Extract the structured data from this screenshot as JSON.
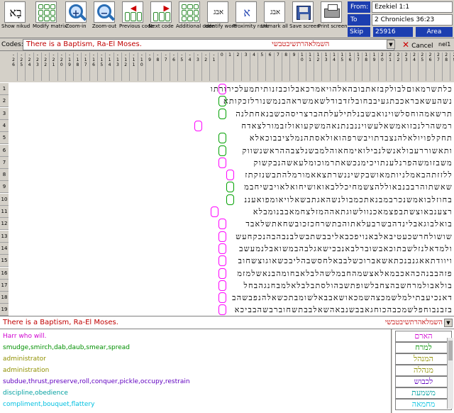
{
  "toolbar": {
    "buttons": [
      {
        "label": "Show nikud",
        "glyph": "בָא"
      },
      {
        "label": "Modify matrix"
      },
      {
        "label": "Zoom-in",
        "glyph": "+"
      },
      {
        "label": "Zoom-out",
        "glyph": "−"
      },
      {
        "label": "Previous code",
        "glyph": "◀"
      },
      {
        "label": "Next code",
        "glyph": "▶"
      },
      {
        "label": "Additional code"
      },
      {
        "label": "Identify word",
        "glyph": "אבג"
      },
      {
        "label": "Proximity rank",
        "glyph": "א"
      },
      {
        "label": "Unmark all",
        "glyph": "אבג"
      },
      {
        "label": "Save screen"
      },
      {
        "label": "Print screen"
      }
    ]
  },
  "range": {
    "from_label": "From:",
    "from_value": "Ezekiel 1:1",
    "to_label": "To",
    "to_value": "2 Chronicles 36:23",
    "skip_label": "Skip",
    "skip_value": "25916",
    "area_label": "Area"
  },
  "codes": {
    "label": "Codes:",
    "value": "There is a Baptism, Ra-El Moses.",
    "hebrew": "השמלאהרתשיבטבשי",
    "cancel_label": "Cancel",
    "user_field": "nel1"
  },
  "matrix": {
    "columns": [
      "-26",
      "-25",
      "-24",
      "-23",
      "-22",
      "-21",
      "-20",
      "-19",
      "-18",
      "-17",
      "-16",
      "-15",
      "-14",
      "-13",
      "-12",
      "-11",
      "-10",
      "-9",
      "-8",
      "-7",
      "-6",
      "-5",
      "-4",
      "-3",
      "-2",
      "-1",
      "0",
      "1",
      "2",
      "3",
      "4",
      "5",
      "6",
      "7",
      "8",
      "9",
      "10",
      "11",
      "12",
      "13",
      "14",
      "15",
      "16",
      "17",
      "18",
      "19",
      "20",
      "21",
      "22",
      "23",
      "24",
      "25",
      "26",
      "27",
      "28",
      "29"
    ],
    "rows": [
      {
        "n": "1",
        "text": "כלתשרמאוםלבולקבזאתבובהאלהויאמרכאבלוכבזנותיתמעלכירורתו"
      },
      {
        "n": "2",
        "text": "נשהעשאבראכבתגעיבבחובלזדבודלשאמשראהבנמשנורלזכקותא"
      },
      {
        "n": "3",
        "text": "תרשאמהוחסלשוינואבשבנלתילעלתהברצריסהכשבנאחתלנה"
      },
      {
        "n": "4",
        "text": "רמשהרלנבזואמשאלעשויננבנתנאהמשקעואולזבמורלצאדח"
      },
      {
        "n": "5",
        "text": "תחקלפויולאלהנצבדתויבשרפהואולאסתהנמלציבבוכאלא"
      },
      {
        "n": "6",
        "text": "ותאשוררעבולאנשלנבילואימחאוהלמבשנלצבההראשנשווק"
      },
      {
        "n": "7",
        "text": "משבזומשהפרנלענתויכימנכשאתרמוכומלעאשהנבקשוק"
      },
      {
        "n": "8",
        "text": "ללזזתהבאמלניותמאושבקשיננשרתצאאמורמלהתבשנזקתז"
      },
      {
        "n": "9",
        "text": "שאשתוהרבבנבאוללהצשמחיכללבאואושיחואלאויבשיחבמ"
      },
      {
        "n": "10",
        "text": "בחוזלבואמשנכרבמבנאתכמבולנשהאגתבשאלויאומפואעננ"
      },
      {
        "n": "11",
        "text": "רצענבאוצשתבפצמאכנוולשוגתאההמזלצחמאבבנומבלא"
      },
      {
        "n": "12",
        "text": "בואלבוגאבלינדהבשרבעלאתוהבתשרחכזכובשחאתשלאבד"
      },
      {
        "n": "13",
        "text": "שושולחרשכעטיבאלבאנויפכבאליבבשתבשלבנבהבהנכקחעש"
      },
      {
        "n": "14",
        "text": "ולמדאלנזלשבתוכאבשוברלבאנבכישאגלבהבמשואבלנמעשב"
      },
      {
        "n": "15",
        "text": "ויוודתאאגנבנכתאשאברוכשלבבאלחסשבהליבכשאוגוצשחוב"
      },
      {
        "n": "16",
        "text": "פזהבבנהכהאכבמאלאצשמהחבמלשהלבלאבחומהבנאשלמזמ"
      },
      {
        "n": "17",
        "text": "בולאבולמרחשבהצחבלשופתשבהולסתבלבלאלמבחנגהבחל"
      },
      {
        "n": "18",
        "text": "דאנכיעבתילמלשמכצהשמכאושאבבאלשומבתכשאלהנפבשהב"
      },
      {
        "n": "19",
        "text": "בזבנבוחפלשמכבהכוחגאבבשנבאהשאלבבתשחוברבשהבביכא"
      }
    ],
    "marks": [
      {
        "row": 1,
        "col": 26,
        "color": "#ff00ff"
      },
      {
        "row": 2,
        "col": 26,
        "color": "#00a000"
      },
      {
        "row": 3,
        "col": 26,
        "color": "#00a000"
      },
      {
        "row": 4,
        "col": 23,
        "color": "#ff00ff"
      },
      {
        "row": 5,
        "col": 26,
        "color": "#00a000"
      },
      {
        "row": 6,
        "col": 26,
        "color": "#00a000"
      },
      {
        "row": 7,
        "col": 26,
        "color": "#ff00ff"
      },
      {
        "row": 8,
        "col": 27,
        "color": "#ff00ff"
      },
      {
        "row": 9,
        "col": 27,
        "color": "#00a000"
      },
      {
        "row": 10,
        "col": 27,
        "color": "#00a000"
      },
      {
        "row": 11,
        "col": 25,
        "color": "#ff00ff"
      },
      {
        "row": 12,
        "col": 26,
        "color": "#ff00ff"
      },
      {
        "row": 13,
        "col": 26,
        "color": "#ff00ff"
      },
      {
        "row": 14,
        "col": 26,
        "color": "#ff00ff"
      },
      {
        "row": 15,
        "col": 26,
        "color": "#ff00ff"
      },
      {
        "row": 16,
        "col": 26,
        "color": "#ff00ff"
      },
      {
        "row": 17,
        "col": 26,
        "color": "#ff00ff"
      },
      {
        "row": 18,
        "col": 26,
        "color": "#ff00ff"
      },
      {
        "row": 19,
        "col": 26,
        "color": "#ff00ff"
      }
    ]
  },
  "phrase": {
    "text": "There is a Baptism, Ra-El Moses.",
    "hebrew": "השמלאהרתשיבטבשי"
  },
  "results": [
    {
      "text": "Harr who will.",
      "color": "#d000d0"
    },
    {
      "text": "smudge,smirch,dab,daub,smear,spread",
      "color": "#009000"
    },
    {
      "text": "administrator",
      "color": "#909000"
    },
    {
      "text": "administration",
      "color": "#909000"
    },
    {
      "text": "subdue,thrust,preserve,roll,conquer,pickle,occupy,restrain",
      "color": "#6000c0"
    },
    {
      "text": "discipline,obedience",
      "color": "#00a0a0"
    },
    {
      "text": "compliment,bouquet,flattery",
      "color": "#00c0e0"
    }
  ],
  "words": [
    {
      "text": "הארם",
      "color": "#d000d0"
    },
    {
      "text": "למרח",
      "color": "#009000"
    },
    {
      "text": "המנהל",
      "color": "#909000"
    },
    {
      "text": "מנהלה",
      "color": "#909000"
    },
    {
      "text": "לכבוש",
      "color": "#6000c0"
    },
    {
      "text": "משמעת",
      "color": "#00a0a0"
    },
    {
      "text": "מחמאה",
      "color": "#00c0e0"
    }
  ]
}
